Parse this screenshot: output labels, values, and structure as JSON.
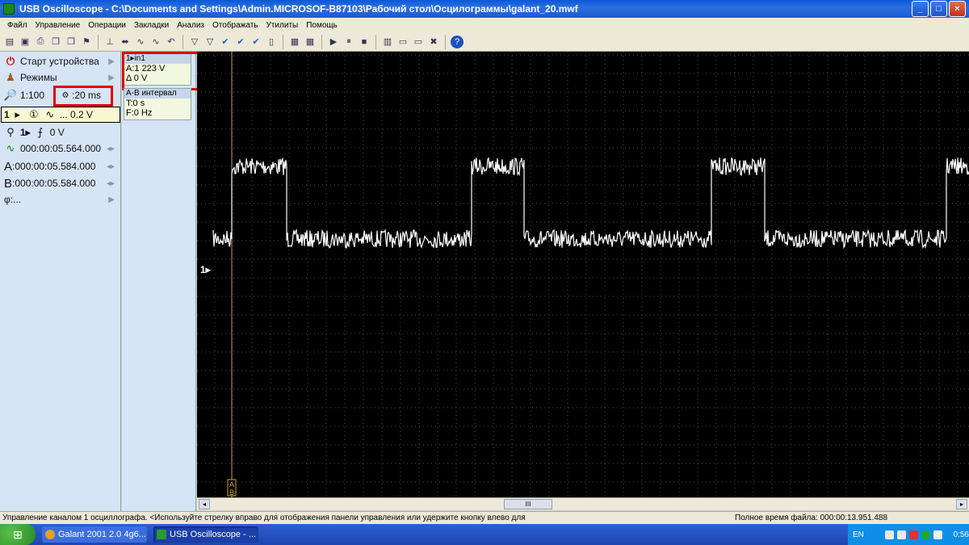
{
  "window": {
    "title": "USB Oscilloscope - C:\\Documents and Settings\\Admin.MICROSOF-B87103\\Рабочий стол\\Осцилограммы\\galant_20.mwf",
    "min_label": "_",
    "max_label": "□",
    "close_label": "×"
  },
  "menu": [
    "Файл",
    "Управление",
    "Операции",
    "Закладки",
    "Анализ",
    "Отображать",
    "Утилиты",
    "Помощь"
  ],
  "toolbar_icons": [
    "open-icon",
    "save-icon",
    "print-icon",
    "copy-icon",
    "copy2-icon",
    "marker-icon",
    "cursor-icon",
    "measure-icon",
    "wave-icon",
    "wave2-icon",
    "undo-icon",
    "filter-icon",
    "filter2-icon",
    "check-icon",
    "check2-icon",
    "check3-icon",
    "page-icon",
    "fft-icon",
    "grid-icon",
    "play-icon",
    "pause-icon",
    "stop-icon",
    "bars-icon",
    "doc-icon",
    "doc2-icon",
    "close-icon",
    "help-icon"
  ],
  "left_panel": {
    "start_device": "Старт устройства",
    "modes": "Режимы",
    "zoom": "1:100",
    "timebase": ":20 ms",
    "channel": "1",
    "channel_volts": "... 0.2 V",
    "trigger_level": "0 V",
    "time1": "000:00:05.564.000",
    "cursor_a_label": "A",
    "cursor_a": ":000:00:05.584.000",
    "cursor_b_label": "B",
    "cursor_b": ":000:00:05.584.000",
    "phi": "φ:..."
  },
  "info_cards": {
    "ch1_header": "1▸in1",
    "ch1_a": "A:1 223 V",
    "ch1_delta": "Δ 0 V",
    "ab_header": "A-B интервал",
    "ab_t": "T:0 s",
    "ab_f": "F:0 Hz"
  },
  "scope": {
    "channel_marker": "1▸",
    "cursor_a": "A",
    "cursor_b": "B",
    "trace_color": "#ffffff",
    "grid_color": "#4a4a4a",
    "background": "#000000"
  },
  "scrollbar": {
    "thumb_label": "III"
  },
  "status": {
    "message": "Управление каналом 1 осциллографа. <Используйте стрелку вправо для отображения панели управления или удержите кнопку влево для",
    "file_time": "Полное время файла: 000:00:13.951.488"
  },
  "taskbar": {
    "items": [
      {
        "label": "Galant 2001 2.0 4g6...",
        "color": "#e8a020"
      },
      {
        "label": "USB Oscilloscope - ...",
        "color": "#2a9a2a"
      }
    ],
    "lang": "EN",
    "clock": "0:56"
  }
}
